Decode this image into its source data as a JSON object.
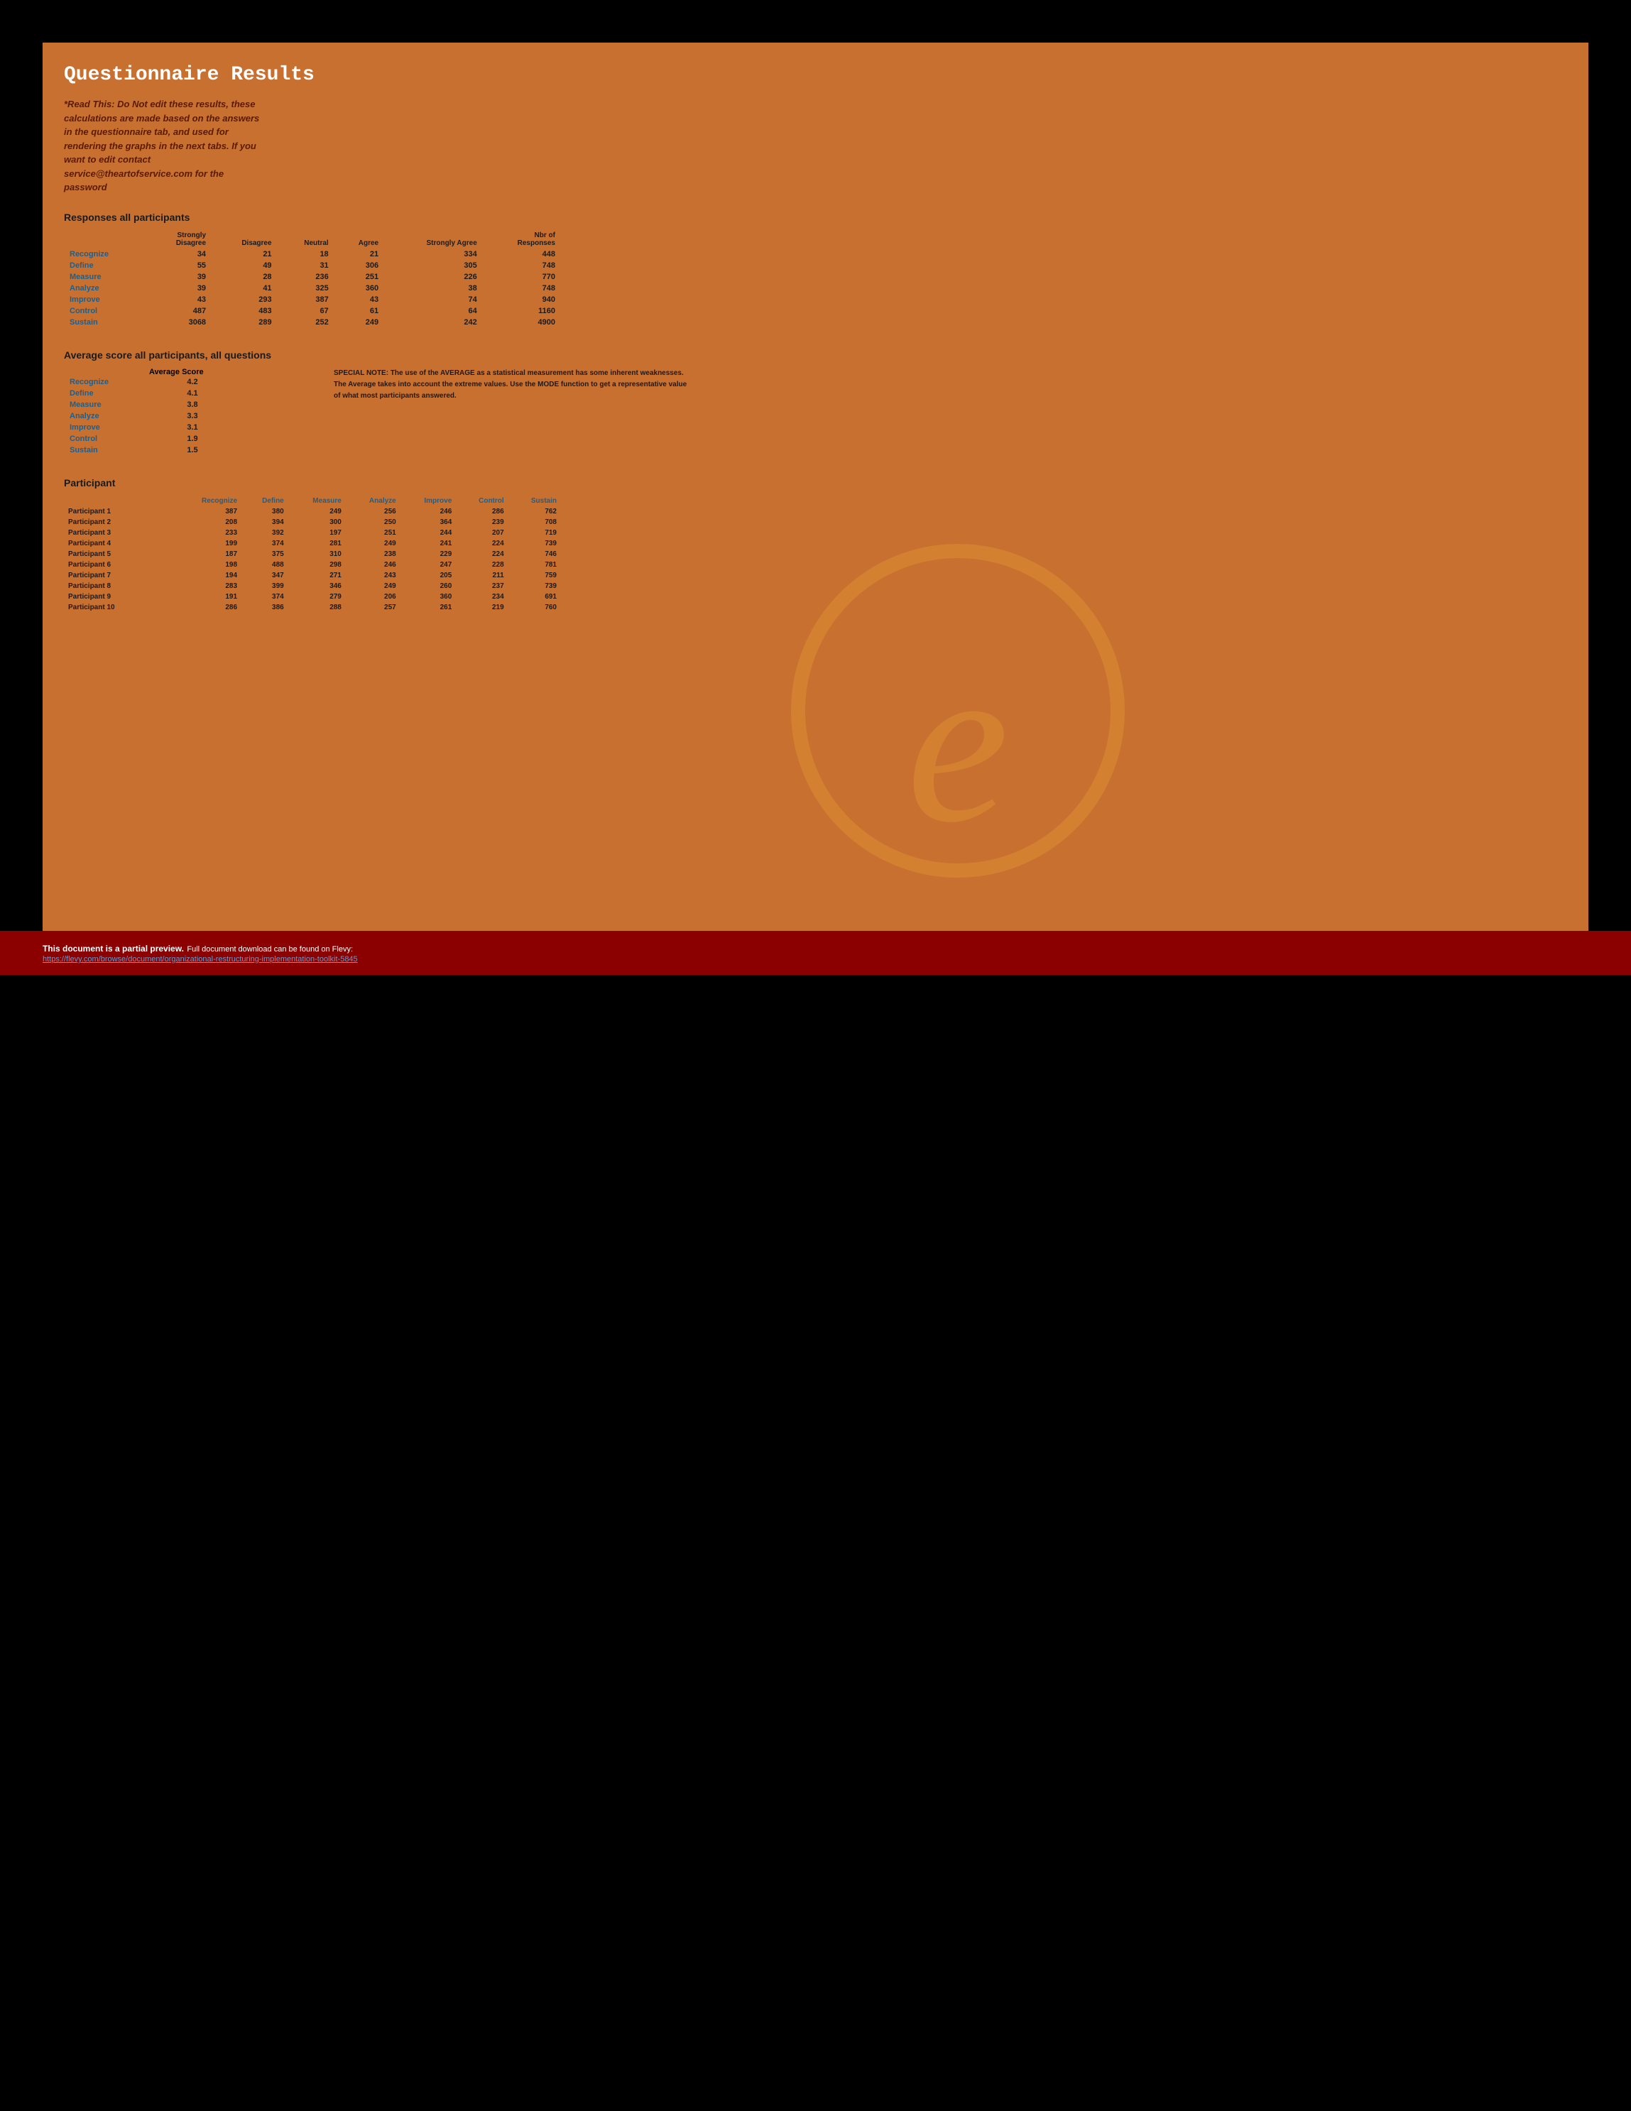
{
  "page": {
    "title": "Questionnaire Results",
    "read_note": "*Read This: Do Not edit these results, these calculations are made based on the answers in the questionnaire tab, and used for rendering the graphs in the next tabs. If you want to edit contact service@theartofservice.com for the password"
  },
  "responses_section": {
    "title": "Responses all participants",
    "columns": [
      "Strongly Disagree",
      "Disagree",
      "Neutral",
      "Agree",
      "Strongly Agree",
      "Nbr of Responses"
    ],
    "rows": [
      {
        "label": "Recognize",
        "sd": 34,
        "d": 21,
        "n": 18,
        "a": 21,
        "sa": 334,
        "total": 448
      },
      {
        "label": "Define",
        "sd": 55,
        "d": 49,
        "n": 31,
        "a": 306,
        "sa": 305,
        "total": 748
      },
      {
        "label": "Measure",
        "sd": 39,
        "d": 28,
        "n": 236,
        "a": 251,
        "sa": 226,
        "total": 770
      },
      {
        "label": "Analyze",
        "sd": 39,
        "d": 41,
        "n": 325,
        "a": 360,
        "sa": 38,
        "total": 748
      },
      {
        "label": "Improve",
        "sd": 43,
        "d": 293,
        "n": 387,
        "a": 43,
        "sa": 74,
        "total": 940
      },
      {
        "label": "Control",
        "sd": 487,
        "d": 483,
        "n": 67,
        "a": 61,
        "sa": 64,
        "total": 1160
      },
      {
        "label": "Sustain",
        "sd": 3068,
        "d": 289,
        "n": 252,
        "a": 249,
        "sa": 242,
        "total": 4900
      }
    ]
  },
  "average_section": {
    "title": "Average score all participants, all questions",
    "col_header": "Average Score",
    "special_note": "SPECIAL NOTE: The use of the AVERAGE as a statistical measurement has some inherent weaknesses.",
    "special_note2": "The Average takes into account the extreme values. Use the MODE function to get a representative value of what most participants answered.",
    "rows": [
      {
        "label": "Recognize",
        "score": "4.2"
      },
      {
        "label": "Define",
        "score": "4.1"
      },
      {
        "label": "Measure",
        "score": "3.8"
      },
      {
        "label": "Analyze",
        "score": "3.3"
      },
      {
        "label": "Improve",
        "score": "3.1"
      },
      {
        "label": "Control",
        "score": "1.9"
      },
      {
        "label": "Sustain",
        "score": "1.5"
      }
    ]
  },
  "participant_section": {
    "title": "Participant",
    "columns": [
      "Recognize",
      "Define",
      "Measure",
      "Analyze",
      "Improve",
      "Control",
      "Sustain"
    ],
    "rows": [
      {
        "name": "Participant 1",
        "recognize": 387,
        "define": 380,
        "measure": 249,
        "analyze": 256,
        "improve": 246,
        "control": 286,
        "sustain": 762
      },
      {
        "name": "Participant 2",
        "recognize": 208,
        "define": 394,
        "measure": 300,
        "analyze": 250,
        "improve": 364,
        "control": 239,
        "sustain": 708
      },
      {
        "name": "Participant 3",
        "recognize": 233,
        "define": 392,
        "measure": 197,
        "analyze": 251,
        "improve": 244,
        "control": 207,
        "sustain": 719
      },
      {
        "name": "Participant 4",
        "recognize": 199,
        "define": 374,
        "measure": 281,
        "analyze": 249,
        "improve": 241,
        "control": 224,
        "sustain": 739
      },
      {
        "name": "Participant 5",
        "recognize": 187,
        "define": 375,
        "measure": 310,
        "analyze": 238,
        "improve": 229,
        "control": 224,
        "sustain": 746
      },
      {
        "name": "Participant 6",
        "recognize": 198,
        "define": 488,
        "measure": 298,
        "analyze": 246,
        "improve": 247,
        "control": 228,
        "sustain": 781
      },
      {
        "name": "Participant 7",
        "recognize": 194,
        "define": 347,
        "measure": 271,
        "analyze": 243,
        "improve": 205,
        "control": 211,
        "sustain": 759
      },
      {
        "name": "Participant 8",
        "recognize": 283,
        "define": 399,
        "measure": 346,
        "analyze": 249,
        "improve": 260,
        "control": 237,
        "sustain": 739
      },
      {
        "name": "Participant 9",
        "recognize": 191,
        "define": 374,
        "measure": 279,
        "analyze": 206,
        "improve": 360,
        "control": 234,
        "sustain": 691
      },
      {
        "name": "Participant 10",
        "recognize": 286,
        "define": 386,
        "measure": 288,
        "analyze": 257,
        "improve": 261,
        "control": 219,
        "sustain": 760
      }
    ]
  },
  "footer": {
    "preview_text": "This document is a partial preview.",
    "full_text": "Full document download can be found on Flevy:",
    "link_text": "https://flevy.com/browse/document/organizational-restructuring-implementation-toolkit-5845"
  }
}
